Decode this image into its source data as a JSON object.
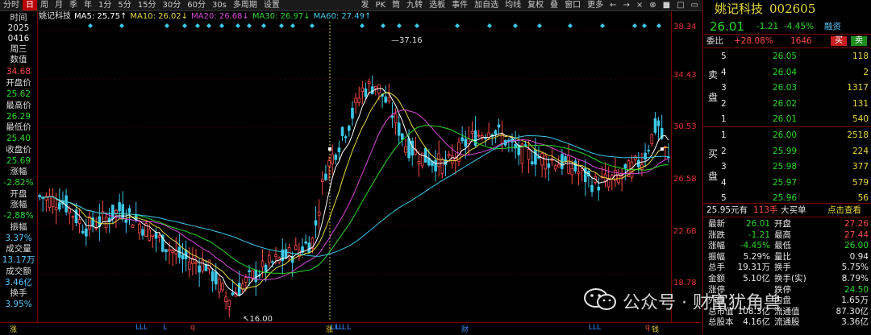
{
  "toolbar": {
    "left_items": [
      "分时",
      "日",
      "周",
      "月",
      "季",
      "年",
      "1分",
      "5分",
      "15分",
      "30分",
      "60分",
      "30s",
      "多周期",
      "设置"
    ],
    "active": "日",
    "right_items": [
      "发",
      "PK",
      "筒",
      "九转",
      "选板",
      "事件",
      "加自选",
      "均线",
      "复权",
      "叠",
      "窗口",
      "更多"
    ],
    "window_icons": [
      "←",
      "→",
      "×",
      "⊗",
      "■",
      "□",
      "▭"
    ]
  },
  "left_panel": {
    "time_label": "时间",
    "year": "2025",
    "date": "0416",
    "weekday": "周三",
    "value_label": "数值",
    "value": "34.68",
    "open_label": "开盘价",
    "open": "25.62",
    "high_label": "最高价",
    "high": "26.29",
    "low_label": "最低价",
    "low": "25.40",
    "close_label": "收盘价",
    "close": "25.69",
    "change_label": "涨幅",
    "change": "-2.82%",
    "open_change_label1": "开盘",
    "open_change_label2": "涨幅",
    "open_change": "-2.88%",
    "amplitude_label": "振幅",
    "amplitude": "3.37%",
    "volume_label": "成交量",
    "volume": "13.17万",
    "amount_label": "成交额",
    "amount": "3.46亿",
    "turnover_label": "换手",
    "turnover": "3.95%"
  },
  "ma_legend": {
    "name": "姚记科技",
    "ma5": "MA5: 25.75↑",
    "ma10": "MA10: 26.02↓",
    "ma20": "MA20: 26.68↓",
    "ma30": "MA30: 26.97↓",
    "ma60": "MA60: 27.49↑",
    "colors": {
      "ma5": "#ffffff",
      "ma10": "#e8d93c",
      "ma20": "#d64ad6",
      "ma30": "#2ad82a",
      "ma60": "#3cc8e8",
      "name": "#e6e6e6"
    }
  },
  "chart_annotations": {
    "high_label": "37.16",
    "low_label": "16.00"
  },
  "price_axis": [
    "38.34",
    "34.43",
    "30.53",
    "26.58",
    "22.68",
    "18.78"
  ],
  "bottom_markers": [
    "涨",
    "LLL",
    "L",
    "q",
    "涨",
    "LLL",
    "L",
    "L",
    "L",
    "财",
    "LLL",
    "q",
    "钱"
  ],
  "quote": {
    "name": "姚记科技",
    "code": "002605",
    "price": "26.01",
    "change": "-1.21",
    "change_pct": "-4.45%",
    "tag": "融资",
    "weibi_label": "委比",
    "weibi": "+28.08%",
    "weicha": "1646",
    "sell_button": "买",
    "buy_button": "卖",
    "sell_side_label": [
      "卖",
      "盘"
    ],
    "buy_side_label": [
      "买",
      "盘"
    ],
    "sells": [
      {
        "level": "5",
        "price": "26.05",
        "vol": "118"
      },
      {
        "level": "4",
        "price": "26.04",
        "vol": "2"
      },
      {
        "level": "3",
        "price": "26.03",
        "vol": "1317"
      },
      {
        "level": "2",
        "price": "26.02",
        "vol": "131"
      },
      {
        "level": "1",
        "price": "26.01",
        "vol": "540"
      }
    ],
    "buys": [
      {
        "level": "1",
        "price": "26.00",
        "vol": "2518"
      },
      {
        "level": "2",
        "price": "25.99",
        "vol": "224"
      },
      {
        "level": "3",
        "price": "25.98",
        "vol": "377"
      },
      {
        "level": "4",
        "price": "25.97",
        "vol": "579"
      },
      {
        "level": "5",
        "price": "25.96",
        "vol": "56"
      }
    ],
    "big_order": {
      "price": "25.95元有",
      "qty": "113手",
      "text": "大买单",
      "link": "点击查看"
    },
    "stats": [
      {
        "l1": "最新",
        "v1": "26.01",
        "l2": "开盘",
        "v2": "27.26"
      },
      {
        "l1": "涨跌",
        "v1": "-1.21",
        "l2": "最高",
        "v2": "27.44"
      },
      {
        "l1": "涨幅",
        "v1": "-4.45%",
        "l2": "最低",
        "v2": "26.00"
      },
      {
        "l1": "振幅",
        "v1": "5.29%",
        "l2": "量比",
        "v2": "0.94"
      },
      {
        "l1": "总手",
        "v1": "19.31万",
        "l2": "换手",
        "v2": "5.75%"
      },
      {
        "l1": "金额",
        "v1": "5.10亿",
        "l2": "换手(实)",
        "v2": "8.79%"
      },
      {
        "l1": "涨停",
        "v1": "",
        "l2": "跌停",
        "v2": "24.50"
      },
      {
        "l1": "外盘",
        "v1": "",
        "l2": "内盘",
        "v2": "1.65万"
      },
      {
        "l1": "总市值",
        "v1": "108.3亿",
        "l2": "流通值",
        "v2": "87.30亿"
      },
      {
        "l1": "总股本",
        "v1": "4.16亿",
        "l2": "流通股",
        "v2": "3.36亿"
      }
    ]
  },
  "watermark": {
    "text": "公众号 · 财富犹角兽"
  },
  "colors": {
    "up": "#ff4b4b",
    "down": "#3cc8e8",
    "frame": "#7a0000",
    "axis_text": "#d33"
  }
}
